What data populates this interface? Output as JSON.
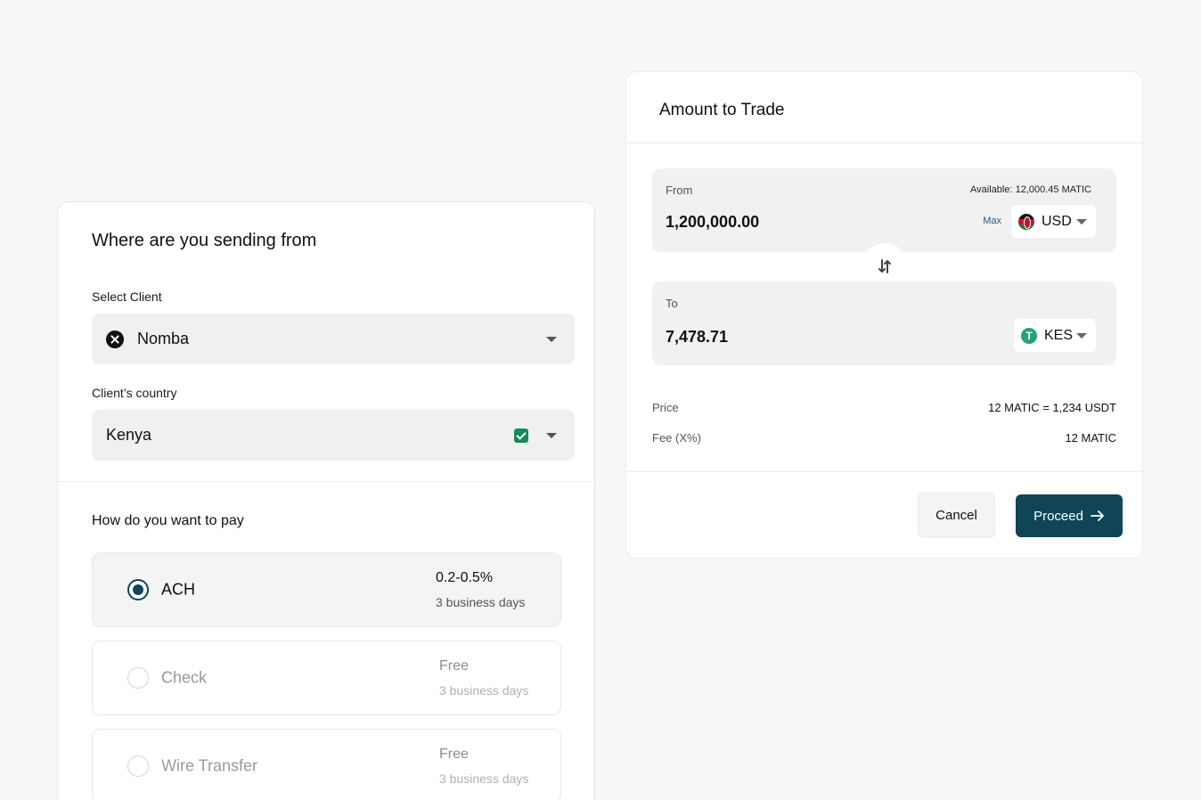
{
  "left": {
    "title": "Where are you sending from",
    "select_client_label": "Select Client",
    "client_value": "Nomba",
    "country_label": "Client’s country",
    "country_value": "Kenya",
    "pay_title": "How do you want to pay",
    "options": [
      {
        "name": "ACH",
        "fee": "0.2-0.5%",
        "days": "3 business days",
        "selected": true
      },
      {
        "name": "Check",
        "fee": "Free",
        "days": "3 business days",
        "selected": false
      },
      {
        "name": "Wire Transfer",
        "fee": "Free",
        "days": "3 business days",
        "selected": false
      }
    ]
  },
  "right": {
    "title": "Amount to Trade",
    "from": {
      "label": "From",
      "value": "1,200,000.00",
      "available": "Available: 12,000.45  MATIC",
      "max": "Max",
      "currency": "USD",
      "icon": "kenya-flag-icon"
    },
    "to": {
      "label": "To",
      "value": "7,478.71",
      "currency": "KES",
      "icon": "tether-icon"
    },
    "price_label": "Price",
    "price_value": "12 MATIC = 1,234 USDT",
    "fee_label": "Fee (X%)",
    "fee_value": "12 MATIC",
    "cancel": "Cancel",
    "proceed": "Proceed"
  },
  "colors": {
    "primary": "#0f4557",
    "check_green": "#178a5c",
    "tether_green": "#26a17b"
  }
}
